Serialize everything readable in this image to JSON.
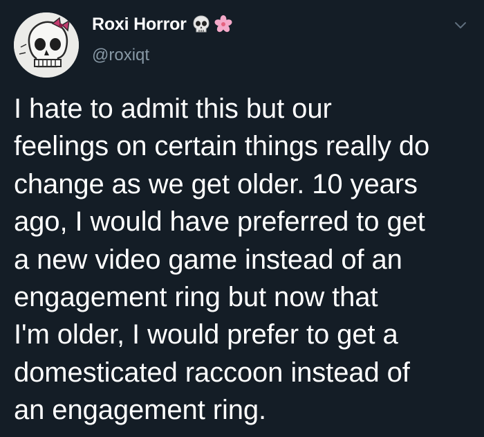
{
  "tweet": {
    "display_name": "Roxi Horror",
    "handle": "@roxiqt",
    "name_emojis": [
      "skull-icon",
      "cherry-blossom-icon"
    ],
    "body_lines": [
      "I hate to admit this but our",
      "feelings on certain things really do",
      "change as we get older. 10 years",
      "ago, I would have preferred to get",
      "a new video game instead of an",
      "engagement ring but now that",
      "I'm older, I would prefer to get a",
      "domesticated raccoon instead of",
      "an engagement ring."
    ]
  },
  "colors": {
    "background": "#141d26",
    "text": "#ffffff",
    "secondary_text": "#8899a6",
    "blossom": "#f4a9c9"
  }
}
